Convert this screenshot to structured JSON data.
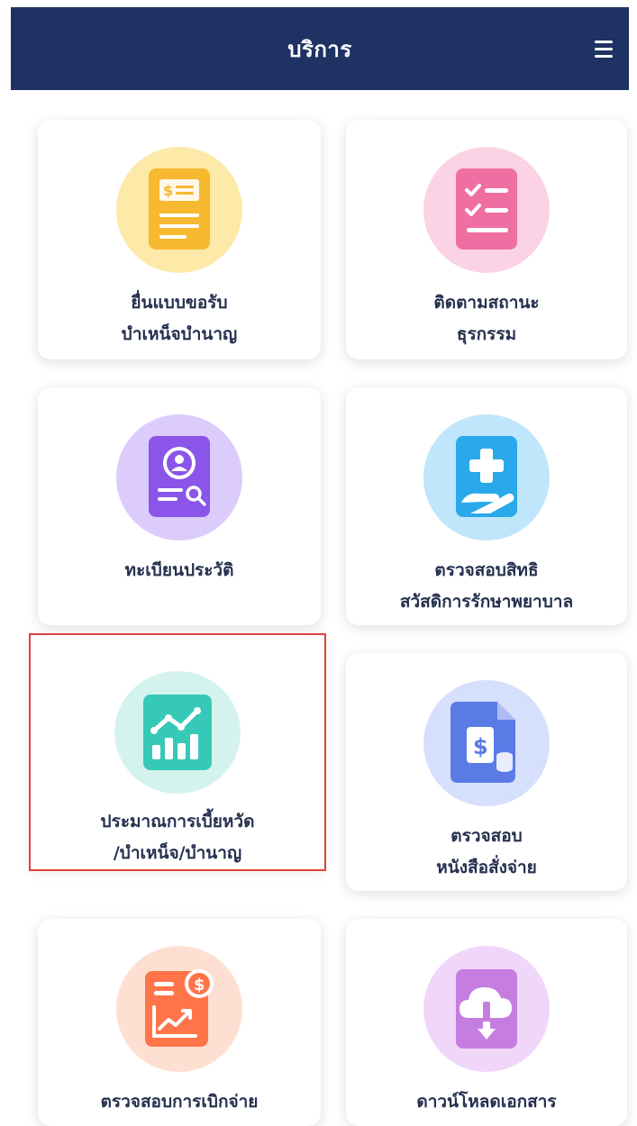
{
  "header": {
    "title": "บริการ",
    "menu_icon": "hamburger-menu-icon",
    "background": "#1f3264"
  },
  "services": [
    {
      "icon": "document-dollar-icon",
      "label_lines": [
        "ยื่นแบบขอรับ",
        "บำเหน็จบำนาญ"
      ],
      "icon_color": "#f7b930",
      "circle_color": "#fde9a8",
      "selected": false
    },
    {
      "icon": "checklist-icon",
      "label_lines": [
        "ติดตามสถานะ",
        "ธุรกรรม"
      ],
      "icon_color": "#ef6fa2",
      "circle_color": "#fbd3e4",
      "selected": false
    },
    {
      "icon": "profile-search-icon",
      "label_lines": [
        "ทะเบียนประวัติ"
      ],
      "icon_color": "#8a55e8",
      "circle_color": "#dcccfb",
      "selected": false
    },
    {
      "icon": "medical-hand-icon",
      "label_lines": [
        "ตรวจสอบสิทธิ",
        "สวัสดิการรักษาพยาบาล"
      ],
      "icon_color": "#29a9ea",
      "circle_color": "#bfe6fb",
      "selected": false
    },
    {
      "icon": "bar-chart-trend-icon",
      "label_lines": [
        "ประมาณการเบี้ยหวัด",
        "/บำเหน็จ/บำนาญ"
      ],
      "icon_color": "#37c9b7",
      "circle_color": "#d4f3ee",
      "selected": true
    },
    {
      "icon": "dollar-document-coins-icon",
      "label_lines": [
        "ตรวจสอบ",
        "หนังสือสั่งจ่าย"
      ],
      "icon_color": "#5a7be6",
      "circle_color": "#d6dffb",
      "selected": false
    },
    {
      "icon": "finance-growth-icon",
      "label_lines": [
        "ตรวจสอบการเบิกจ่าย"
      ],
      "icon_color": "#ff7448",
      "circle_color": "#fde0d2",
      "selected": false
    },
    {
      "icon": "cloud-download-icon",
      "label_lines": [
        "ดาวน์โหลดเอกสาร"
      ],
      "icon_color": "#c57de0",
      "circle_color": "#f0d6f8",
      "selected": false
    }
  ]
}
